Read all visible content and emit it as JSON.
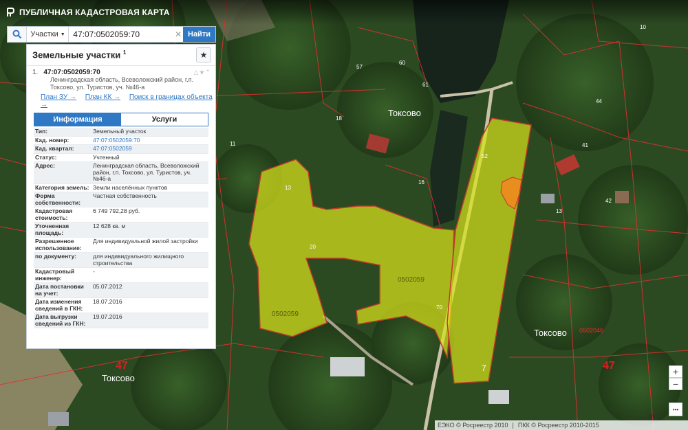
{
  "app": {
    "title": "ПУБЛИЧНАЯ КАДАСТРОВАЯ КАРТА"
  },
  "search": {
    "type": "Участки",
    "value": "47:07:0502059:70",
    "button": "Найти"
  },
  "panel": {
    "title": "Земельные участки",
    "title_sup": "1",
    "item": {
      "index": "1.",
      "number": "47:07:0502059:70",
      "address": "Ленинградская область, Всеволожский район, г.п. Токсово, ул. Туристов, уч. №46-а"
    },
    "links": [
      "План ЗУ →",
      "План КК →",
      "Поиск в границах объекта →"
    ],
    "tabs": [
      "Информация",
      "Услуги"
    ],
    "rows": [
      {
        "label": "Тип:",
        "value": "Земельный участок"
      },
      {
        "label": "Кад. номер:",
        "value": "47:07:0502059:70"
      },
      {
        "label": "Кад. квартал:",
        "value": "47:07:0502059"
      },
      {
        "label": "Статус:",
        "value": "Учтенный"
      },
      {
        "label": "Адрес:",
        "value": "Ленинградская область, Всеволожский район, г.п. Токсово, ул. Туристов, уч. №46-а"
      },
      {
        "label": "Категория земель:",
        "value": "Земли населённых пунктов"
      },
      {
        "label": "Форма собственности:",
        "value": "Частная собственность"
      },
      {
        "label": "Кадастровая стоимость:",
        "value": "6 749 792,28 руб."
      },
      {
        "label": "Уточненная площадь:",
        "value": "12 628 кв. м"
      },
      {
        "label": "Разрешенное использование:",
        "value": "Для индивидуальной жилой застройки"
      },
      {
        "label": "по документу:",
        "value": "для индивидуального жилищного строительства"
      },
      {
        "label": "Кадастровый инженер:",
        "value": "-"
      },
      {
        "label": "Дата постановки на учет:",
        "value": "05.07.2012"
      },
      {
        "label": "Дата изменения сведений в ГКН:",
        "value": "18.07.2016"
      },
      {
        "label": "Дата выгрузки сведений из ГКН:",
        "value": "19.07.2016"
      }
    ]
  },
  "map": {
    "place_labels": [
      "Токсово",
      "Токсово",
      "Токсово"
    ],
    "road_numbers": [
      "47",
      "47"
    ],
    "parcel_labels": [
      "0502059",
      "0502059",
      "0502046"
    ],
    "lot_numbers": [
      "20",
      "70",
      "7",
      "13",
      "52",
      "61",
      "18",
      "16",
      "42",
      "44",
      "41",
      "57",
      "60",
      "11",
      "13",
      "10"
    ],
    "zoom_in": "+",
    "zoom_out": "−",
    "more": "•••",
    "scale": "30м"
  },
  "colors": {
    "parcel": "#d8e21a",
    "boundary": "#e03030",
    "highlight": "#f08a20",
    "accent": "#2f78c4"
  },
  "footer": {
    "left": "ЕЭКО © Росреестр 2010",
    "right": "ПКК © Росреестр 2010-2015"
  }
}
